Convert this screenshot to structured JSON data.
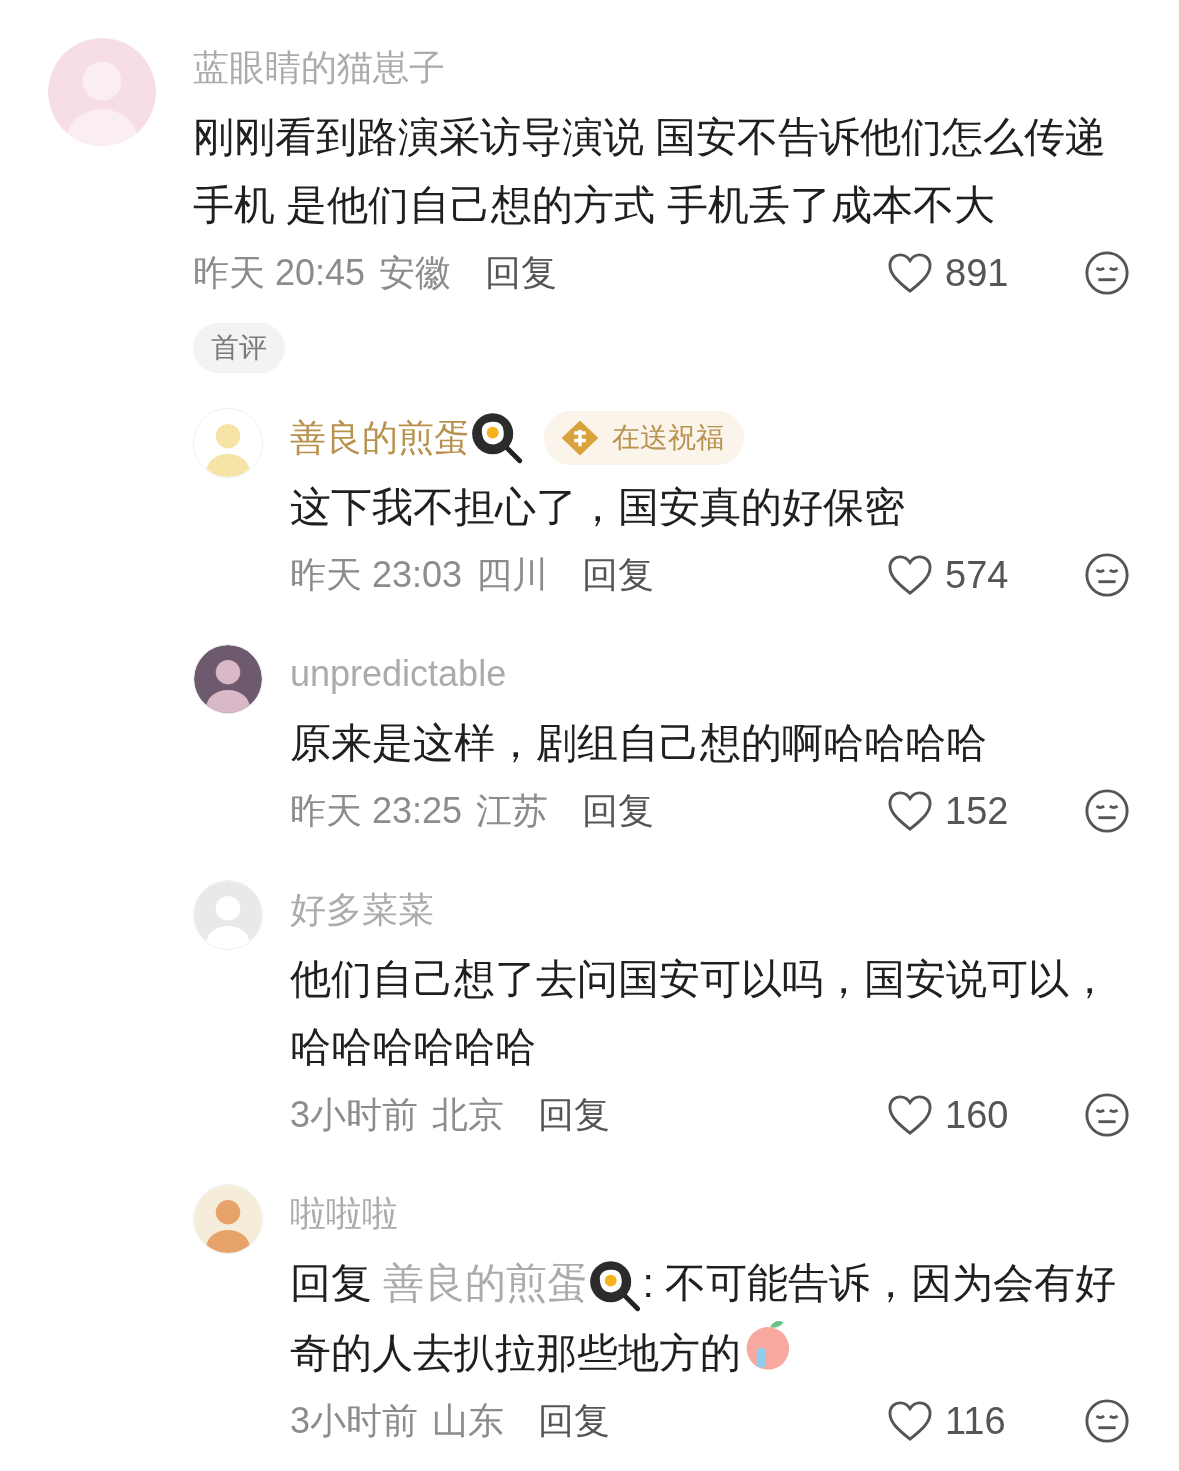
{
  "comment": {
    "name": "蓝眼睛的猫崽子",
    "vip": false,
    "body": "刚刚看到路演采访导演说 国安不告诉他们怎么传递手机 是他们自己想的方式 手机丢了成本不大",
    "time": "昨天 20:45",
    "location": "安徽",
    "reply_label": "回复",
    "likes": "891",
    "liked": false,
    "tag": "首评",
    "replies": [
      {
        "name": "善良的煎蛋",
        "vip": true,
        "name_emoji": true,
        "badge": "在送祝福",
        "body": "这下我不担心了，国安真的好保密",
        "time": "昨天 23:03",
        "location": "四川",
        "reply_label": "回复",
        "likes": "574",
        "liked": false
      },
      {
        "name": "unpredictable",
        "vip": false,
        "body": "原来是这样，剧组自己想的啊哈哈哈哈",
        "time": "昨天 23:25",
        "location": "江苏",
        "reply_label": "回复",
        "likes": "152",
        "liked": false
      },
      {
        "name": "好多菜菜",
        "vip": false,
        "body": "他们自己想了去问国安可以吗，国安说可以，哈哈哈哈哈哈",
        "time": "3小时前",
        "location": "北京",
        "reply_label": "回复",
        "likes": "160",
        "liked": false
      },
      {
        "name": "啦啦啦",
        "vip": false,
        "body_prefix": "回复",
        "reply_to": "善良的煎蛋",
        "reply_to_emoji": true,
        "body": ": 不可能告诉，因为会有好奇的人去扒拉那些地方的",
        "trailing_emoji": true,
        "time": "3小时前",
        "location": "山东",
        "reply_label": "回复",
        "likes": "116",
        "liked": false
      }
    ]
  }
}
